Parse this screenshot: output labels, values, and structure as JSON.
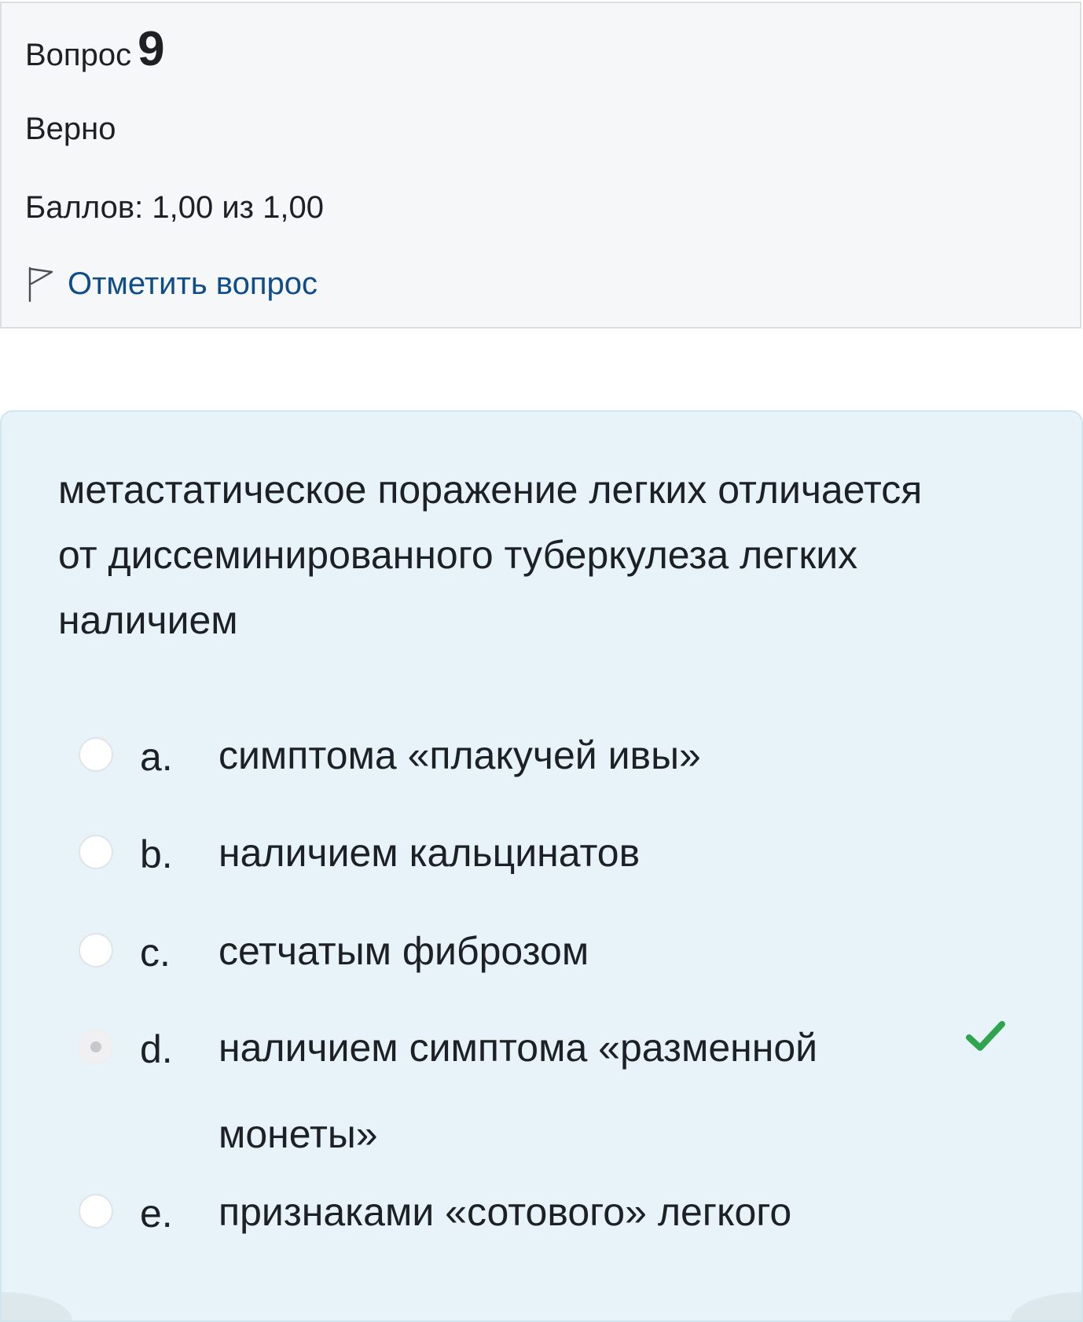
{
  "question_info": {
    "word": "Вопрос",
    "number": "9",
    "state": "Верно",
    "grade": "Баллов: 1,00 из 1,00",
    "flag_label": "Отметить вопрос",
    "flag_icon": "flag-icon"
  },
  "question": {
    "text": "метастатическое поражение легких отличается от диссеминированного туберкулеза легких наличием",
    "answers": [
      {
        "letter": "a.",
        "text": "симптома «плакучей ивы»",
        "selected": false,
        "correct_mark": false
      },
      {
        "letter": "b.",
        "text": "наличием кальцинатов",
        "selected": false,
        "correct_mark": false
      },
      {
        "letter": "c.",
        "text": "сетчатым фиброзом",
        "selected": false,
        "correct_mark": false
      },
      {
        "letter": "d.",
        "text": "наличием симптома «разменной монеты»",
        "selected": true,
        "correct_mark": true
      },
      {
        "letter": "e.",
        "text": "признаками «сотового» легкого",
        "selected": false,
        "correct_mark": false
      }
    ],
    "check_icon": "check-icon",
    "check_color": "#2ea44f"
  },
  "colors": {
    "info_background": "#f5f7f8",
    "content_background": "#e7f3f8",
    "link": "#0f4c8a",
    "text": "#1d2125"
  }
}
